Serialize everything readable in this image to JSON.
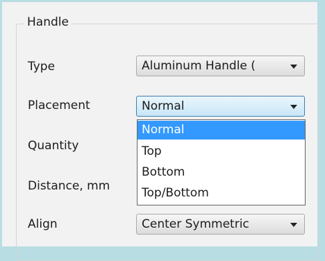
{
  "group": {
    "title": "Handle"
  },
  "fields": {
    "type_label": "Type",
    "type_value": "Aluminum Handle (",
    "placement_label": "Placement",
    "placement_value": "Normal",
    "quantity_label": "Quantity",
    "distance_label": "Distance, mm",
    "align_label": "Align",
    "align_value": "Center Symmetric"
  },
  "placement_options": [
    "Normal",
    "Top",
    "Bottom",
    "Top/Bottom"
  ],
  "placement_selected": "Normal",
  "icons": {
    "dropdown_arrow": "chevron-down-icon"
  }
}
